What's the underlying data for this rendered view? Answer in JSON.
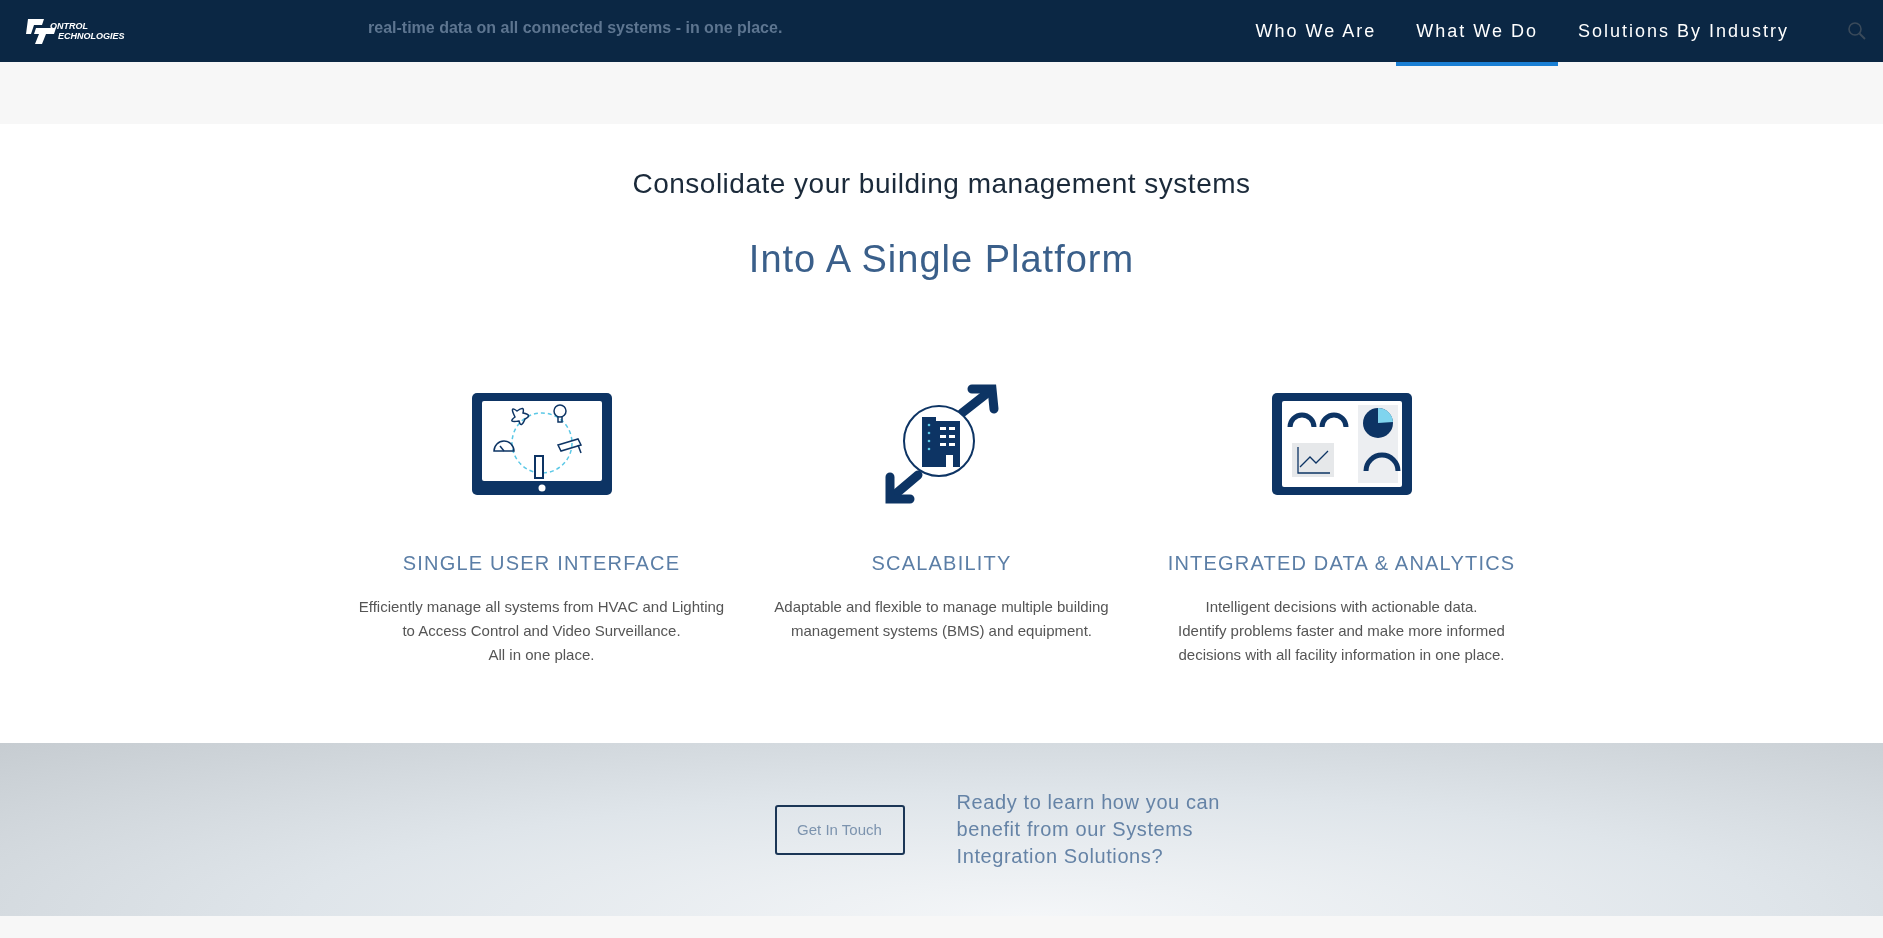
{
  "header": {
    "logo": {
      "line_1": "ONTROL",
      "line_2": "ECHNOLOGIES"
    },
    "background_text": "real-time data on all connected systems - in one place.",
    "nav": [
      {
        "label": "Who We Are",
        "selected": false
      },
      {
        "label": "What We Do",
        "selected": true
      },
      {
        "label": "Solutions By Industry",
        "selected": false
      }
    ]
  },
  "intro": {
    "subtitle": "Consolidate your building management systems",
    "title": "Into A Single Platform"
  },
  "features": [
    {
      "kind": "interface",
      "title": "SINGLE USER INTERFACE",
      "lines": [
        "Efficiently manage all systems from HVAC and Lighting",
        "to Access Control and Video Surveillance.",
        "All in one place."
      ]
    },
    {
      "kind": "scale",
      "title": "SCALABILITY",
      "lines": [
        "Adaptable and flexible to manage multiple building",
        "management systems (BMS) and equipment."
      ]
    },
    {
      "kind": "analytics",
      "title": "INTEGRATED DATA & ANALYTICS",
      "lines": [
        "Intelligent decisions with actionable data.",
        "Identify problems faster and make more informed",
        "decisions with all facility information in one place."
      ]
    }
  ],
  "cta": {
    "button": "Get In Touch",
    "text": "Ready to learn how you can benefit from our Systems Integration Solutions?"
  }
}
